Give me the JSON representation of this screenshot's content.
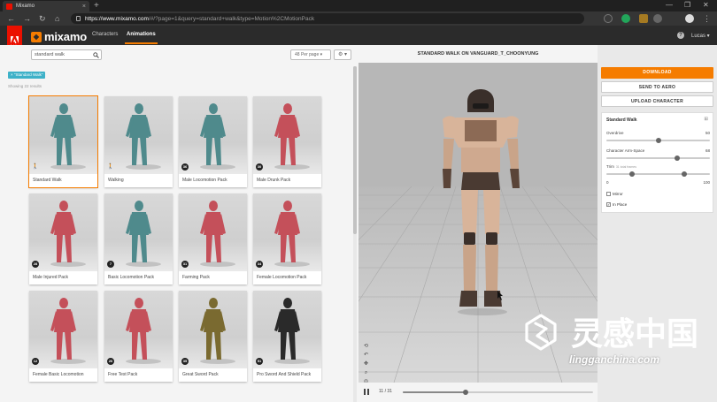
{
  "browser": {
    "tab_title": "Mixamo",
    "tab_close": "×",
    "new_tab": "+",
    "url_domain": "https://www.mixamo.com",
    "url_path": "/#/?page=1&query=standard+walk&type=Motion%2CMotionPack",
    "controls": [
      "—",
      "❐",
      "✕"
    ]
  },
  "header": {
    "adobe_text": "Adobe",
    "logo_text": "mixamo",
    "tabs": [
      "Characters",
      "Animations"
    ],
    "active_tab": "Animations",
    "help": "?",
    "user_label": "Lucas ▾"
  },
  "left": {
    "search_value": "standard walk",
    "per_page": "48 Per page",
    "gear": "⚙ ▾",
    "tag": "× \"Standard Walk\"",
    "results": "Showing 22 results",
    "cards": [
      {
        "label": "Standard Walk",
        "color": "#4f8a8c",
        "selected": true,
        "badge": ""
      },
      {
        "label": "Walking",
        "color": "#4f8a8c",
        "selected": false,
        "badge": ""
      },
      {
        "label": "Male Locomotion Pack",
        "color": "#4f8a8c",
        "selected": false,
        "badge": "36"
      },
      {
        "label": "Male Drunk Pack",
        "color": "#c4505a",
        "selected": false,
        "badge": "30"
      },
      {
        "label": "Male Injured Pack",
        "color": "#c4505a",
        "selected": false,
        "badge": "28"
      },
      {
        "label": "Basic Locomotion Pack",
        "color": "#4f8a8c",
        "selected": false,
        "badge": "7"
      },
      {
        "label": "Farming Pack",
        "color": "#c4505a",
        "selected": false,
        "badge": "31"
      },
      {
        "label": "Female Locomotion Pack",
        "color": "#c4505a",
        "selected": false,
        "badge": "34"
      },
      {
        "label": "Female Basic Locomotion",
        "color": "#c4505a",
        "selected": false,
        "badge": "12"
      },
      {
        "label": "Free Test Pack",
        "color": "#c4505a",
        "selected": false,
        "badge": "26"
      },
      {
        "label": "Great Sword Pack",
        "color": "#7a6a30",
        "selected": false,
        "badge": "35"
      },
      {
        "label": "Pro Sword And Shield Pack",
        "color": "#2a2a2a",
        "selected": false,
        "badge": "51"
      }
    ]
  },
  "viewer": {
    "title": "STANDARD WALK ON VANGUARD_T_CHOONYUNG",
    "frames": "11 / 31",
    "progress": 0.33
  },
  "right": {
    "download": "DOWNLOAD",
    "send": "SEND TO AERO",
    "upload": "UPLOAD CHARACTER",
    "settings_title": "Standard Walk",
    "settings_icon": "⊞",
    "overdrive_label": "Overdrive",
    "overdrive_value": "50",
    "overdrive_frac": 0.5,
    "armspace_label": "Character Arm-Space",
    "armspace_value": "68",
    "armspace_frac": 0.68,
    "trim_label": "Trim",
    "trim_note": "31 total frames",
    "trim_min": "0",
    "trim_max": "100",
    "trim_low_frac": 0.25,
    "trim_high_frac": 0.75,
    "mirror_label": "Mirror",
    "mirror_checked": false,
    "inplace_label": "In Place",
    "inplace_checked": true
  },
  "watermark": {
    "url": "lingganchina.com",
    "chars": "灵感中国"
  },
  "colors": {
    "accent": "#f57c00",
    "adobe": "#eb1000",
    "tag": "#3db1c8"
  }
}
